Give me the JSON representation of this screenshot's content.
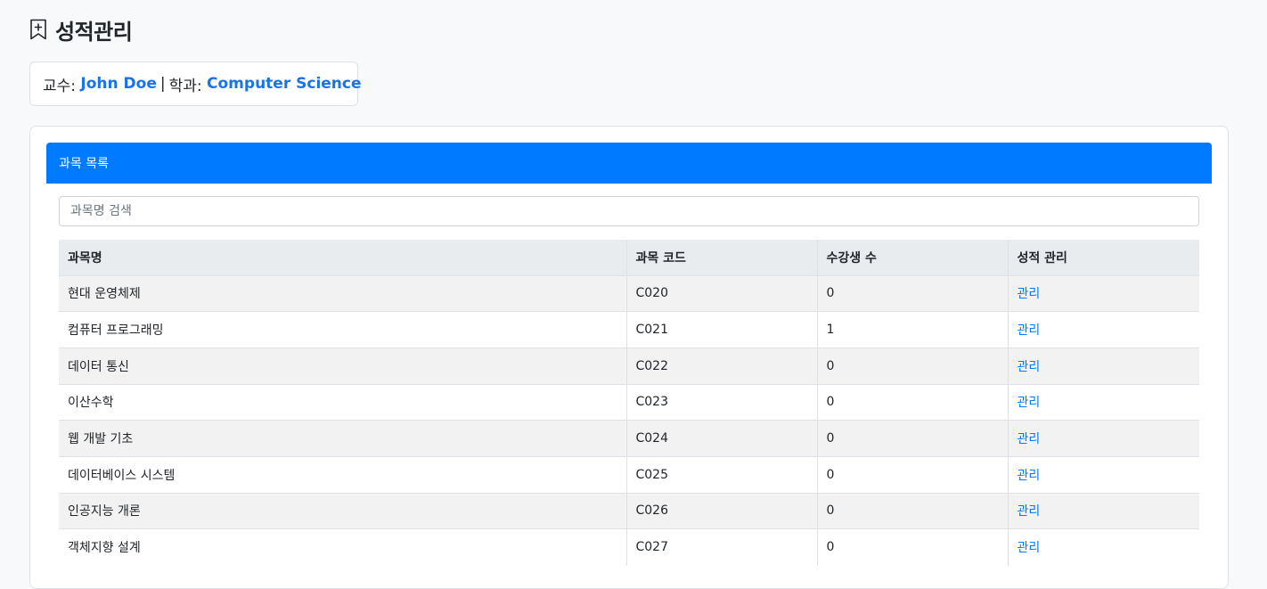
{
  "header": {
    "icon": "bookmark-plus-icon",
    "title": "성적관리"
  },
  "info": {
    "professor_label": "교수:",
    "professor_name": "John Doe",
    "separator": "|",
    "department_label": "학과:",
    "department_name": "Computer Science"
  },
  "card": {
    "header_title": "과목 목록"
  },
  "search": {
    "placeholder": "과목명 검색",
    "value": ""
  },
  "table": {
    "headers": [
      "과목명",
      "과목 코드",
      "수강생 수",
      "성적 관리"
    ],
    "rows": [
      {
        "name": "현대 운영체제",
        "code": "C020",
        "students": "0",
        "action": "관리"
      },
      {
        "name": "컴퓨터 프로그래밍",
        "code": "C021",
        "students": "1",
        "action": "관리"
      },
      {
        "name": "데이터 통신",
        "code": "C022",
        "students": "0",
        "action": "관리"
      },
      {
        "name": "이산수학",
        "code": "C023",
        "students": "0",
        "action": "관리"
      },
      {
        "name": "웹 개발 기초",
        "code": "C024",
        "students": "0",
        "action": "관리"
      },
      {
        "name": "데이터베이스 시스템",
        "code": "C025",
        "students": "0",
        "action": "관리"
      },
      {
        "name": "인공지능 개론",
        "code": "C026",
        "students": "0",
        "action": "관리"
      },
      {
        "name": "객체지향 설계",
        "code": "C027",
        "students": "0",
        "action": "관리"
      }
    ]
  },
  "colors": {
    "accent": "#007bff",
    "highlight_text": "#1a73e8",
    "background": "#f8f9fa"
  }
}
